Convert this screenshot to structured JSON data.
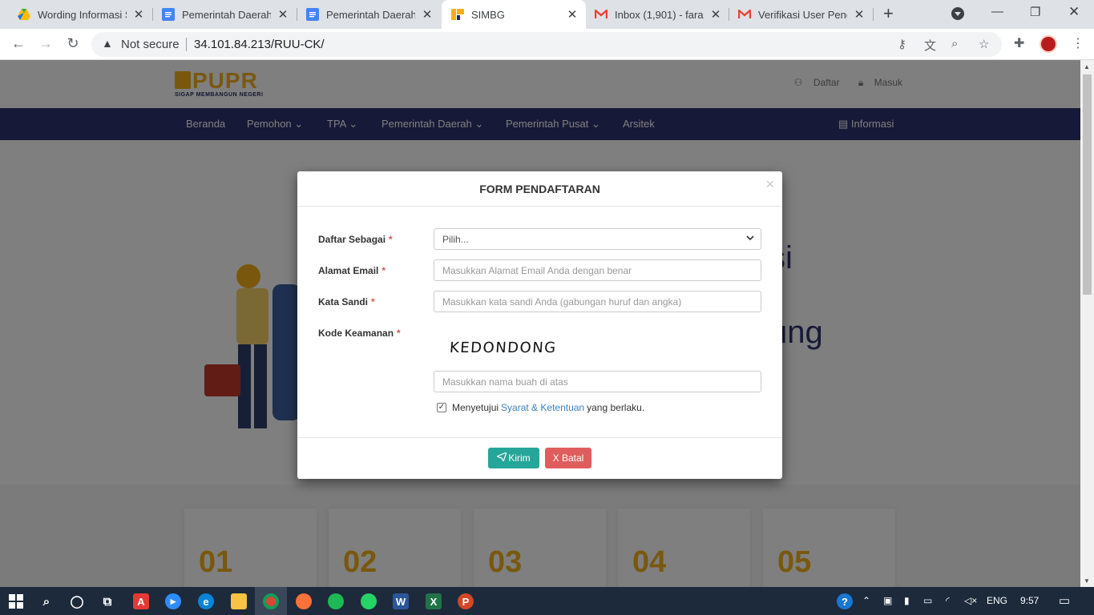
{
  "browser": {
    "tabs": [
      {
        "title": "Wording Informasi S",
        "icon": "drive-icon"
      },
      {
        "title": "Pemerintah Daerah",
        "icon": "docs-icon"
      },
      {
        "title": "Pemerintah Daerah",
        "icon": "docs-icon"
      },
      {
        "title": "SIMBG",
        "icon": "pupr-icon",
        "active": true
      },
      {
        "title": "Inbox (1,901) - fara",
        "icon": "gmail-icon"
      },
      {
        "title": "Verifikasi User Peng",
        "icon": "gmail-icon"
      }
    ],
    "security_label": "Not secure",
    "url": "34.101.84.213/RUU-CK/"
  },
  "site": {
    "logo_text": "PUPR",
    "logo_tagline": "SIGAP MEMBANGUN NEGERI",
    "top_links": {
      "register": "Daftar",
      "login": "Masuk"
    },
    "nav": [
      "Beranda",
      "Pemohon",
      "TPA",
      "Pemerintah Daerah",
      "Pemerintah Pusat",
      "Arsitek"
    ],
    "nav_info": "Informasi",
    "hero_fragments": [
      "si",
      "ung"
    ],
    "cards": [
      "01",
      "02",
      "03",
      "04",
      "05"
    ]
  },
  "modal": {
    "title": "FORM PENDAFTARAN",
    "close": "×",
    "fields": {
      "role": {
        "label": "Daftar Sebagai",
        "value": "Pilih..."
      },
      "email": {
        "label": "Alamat Email",
        "placeholder": "Masukkan Alamat Email Anda dengan benar"
      },
      "password": {
        "label": "Kata Sandi",
        "placeholder": "Masukkan kata sandi Anda (gabungan huruf dan angka)"
      },
      "captcha": {
        "label": "Kode Keamanan",
        "image_text": "KEDONDONG",
        "placeholder": "Masukkan nama buah di atas"
      }
    },
    "required_mark": "*",
    "agree": {
      "prefix": "Menyetujui",
      "link": "Syarat & Ketentuan",
      "suffix": "yang berlaku.",
      "checked": true
    },
    "buttons": {
      "send": "Kirim",
      "cancel": "X Batal"
    }
  },
  "taskbar": {
    "language": "ENG",
    "time": "9:57"
  },
  "colors": {
    "nav": "#2e3270",
    "accent": "#f3b01c",
    "send": "#26a69a",
    "cancel": "#e05d5d"
  }
}
